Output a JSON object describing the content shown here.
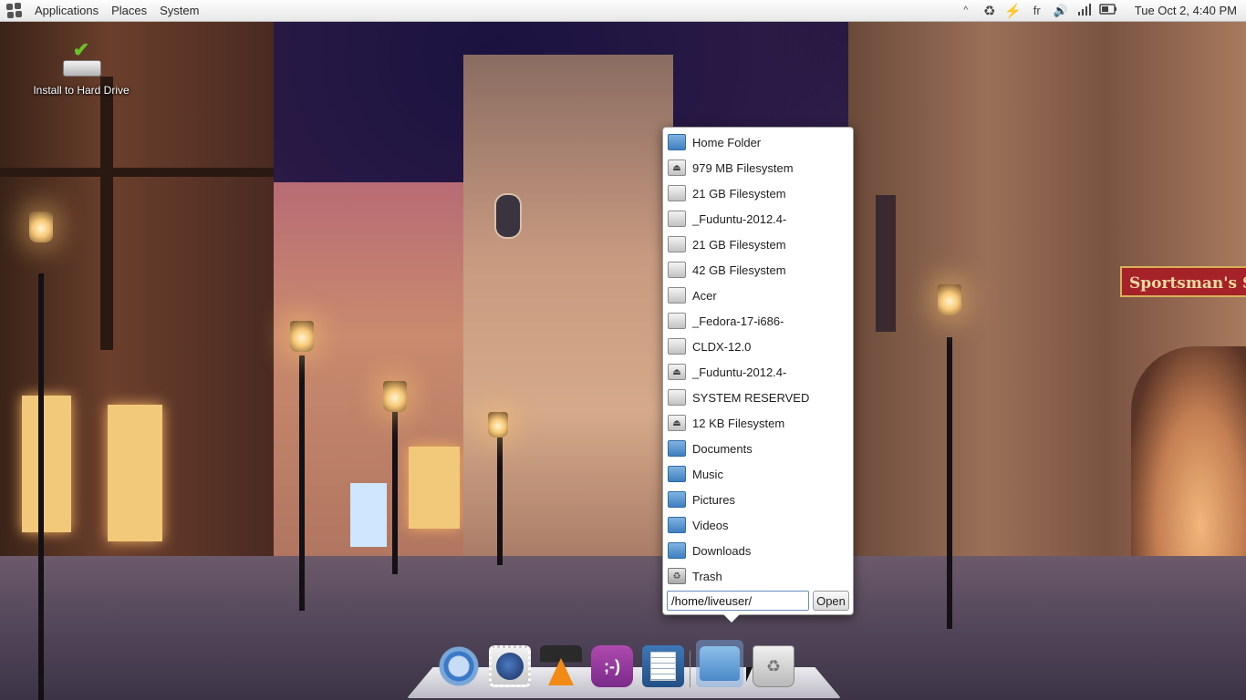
{
  "top_panel": {
    "logo_icon": "gnome-foot-icon",
    "menus": [
      "Applications",
      "Places",
      "System"
    ],
    "tray": {
      "arrow_label": "^",
      "keyboard_layout": "fr",
      "clock": "Tue Oct  2,  4:40 PM"
    }
  },
  "desktop": {
    "install_label": "Install to Hard Drive",
    "sign_text": "Sportsman's Sh"
  },
  "places_popup": {
    "items": [
      {
        "label": "Home Folder",
        "icon": "home-folder-icon",
        "kind": "folder"
      },
      {
        "label": "979 MB Filesystem",
        "icon": "eject-drive-icon",
        "kind": "eject"
      },
      {
        "label": "21 GB Filesystem",
        "icon": "drive-icon",
        "kind": "drive"
      },
      {
        "label": "_Fuduntu-2012.4-",
        "icon": "drive-icon",
        "kind": "drive"
      },
      {
        "label": "21 GB Filesystem",
        "icon": "drive-icon",
        "kind": "drive"
      },
      {
        "label": "42 GB Filesystem",
        "icon": "drive-icon",
        "kind": "drive"
      },
      {
        "label": "Acer",
        "icon": "drive-icon",
        "kind": "drive"
      },
      {
        "label": "_Fedora-17-i686-",
        "icon": "drive-icon",
        "kind": "drive"
      },
      {
        "label": "CLDX-12.0",
        "icon": "drive-icon",
        "kind": "drive"
      },
      {
        "label": "_Fuduntu-2012.4-",
        "icon": "eject-drive-icon",
        "kind": "eject"
      },
      {
        "label": "SYSTEM RESERVED",
        "icon": "drive-icon",
        "kind": "drive"
      },
      {
        "label": "12 KB Filesystem",
        "icon": "eject-drive-icon",
        "kind": "eject"
      },
      {
        "label": "Documents",
        "icon": "documents-folder-icon",
        "kind": "folder"
      },
      {
        "label": "Music",
        "icon": "music-folder-icon",
        "kind": "folder"
      },
      {
        "label": "Pictures",
        "icon": "pictures-folder-icon",
        "kind": "folder"
      },
      {
        "label": "Videos",
        "icon": "videos-folder-icon",
        "kind": "folder"
      },
      {
        "label": "Downloads",
        "icon": "downloads-folder-icon",
        "kind": "folder"
      },
      {
        "label": "Trash",
        "icon": "trash-icon",
        "kind": "trash"
      }
    ],
    "path_value": "/home/liveuser/",
    "open_label": "Open"
  },
  "dock": {
    "apps": [
      "chromium-icon",
      "mail-stamp-icon",
      "vlc-icon",
      "chat-icon",
      "text-editor-icon",
      "files-icon",
      "trash-icon"
    ],
    "chat_glyph": ";-)"
  }
}
